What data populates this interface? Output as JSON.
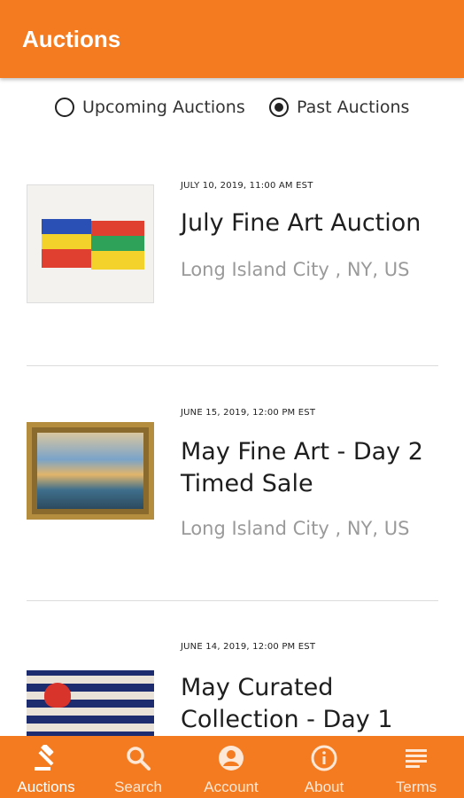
{
  "appbar": {
    "title": "Auctions"
  },
  "filter": {
    "options": [
      {
        "label": "Upcoming Auctions",
        "selected": false
      },
      {
        "label": "Past Auctions",
        "selected": true
      }
    ]
  },
  "auctions": [
    {
      "date": "JULY 10, 2019, 11:00 AM EST",
      "title": "July Fine Art Auction",
      "location": "Long Island City , NY, US"
    },
    {
      "date": "JUNE 15, 2019, 12:00 PM EST",
      "title": "May Fine Art - Day 2 Timed Sale",
      "location": "Long Island City , NY, US"
    },
    {
      "date": "JUNE 14, 2019, 12:00 PM EST",
      "title": "May Curated Collection - Day 1",
      "location": ""
    }
  ],
  "bottom_nav": {
    "items": [
      {
        "label": "Auctions",
        "icon": "gavel-icon",
        "active": true
      },
      {
        "label": "Search",
        "icon": "search-icon",
        "active": false
      },
      {
        "label": "Account",
        "icon": "account-icon",
        "active": false
      },
      {
        "label": "About",
        "icon": "info-icon",
        "active": false
      },
      {
        "label": "Terms",
        "icon": "document-icon",
        "active": false
      }
    ]
  },
  "colors": {
    "accent": "#f47b20",
    "text": "#1e1e1e",
    "muted": "#9a9a9a"
  }
}
